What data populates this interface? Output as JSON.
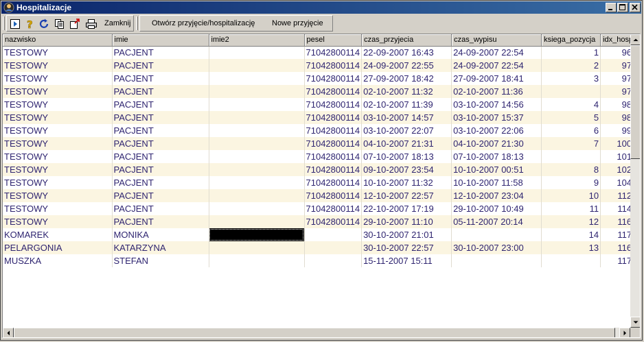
{
  "window": {
    "title": "Hospitalizacje"
  },
  "toolbar": {
    "icons": [
      "run-icon",
      "help-icon",
      "refresh-icon",
      "copy-icon",
      "export-icon",
      "print-icon"
    ],
    "close_label": "Zamknij",
    "open_admission_label": "Otwórz przyjęcie/hospitalizację",
    "new_admission_label": "Nowe przyjęcie"
  },
  "table": {
    "columns": [
      "nazwisko",
      "imie",
      "imie2",
      "pesel",
      "czas_przyjecia",
      "czas_wypisu",
      "ksiega_pozycja",
      "idx_hosp"
    ],
    "rows": [
      [
        "TESTOWY",
        "PACJENT",
        "",
        "71042800114",
        "22-09-2007 16:43",
        "24-09-2007 22:54",
        "1",
        "96"
      ],
      [
        "TESTOWY",
        "PACJENT",
        "",
        "71042800114",
        "24-09-2007 22:55",
        "24-09-2007 22:54",
        "2",
        "97"
      ],
      [
        "TESTOWY",
        "PACJENT",
        "",
        "71042800114",
        "27-09-2007 18:42",
        "27-09-2007 18:41",
        "3",
        "97"
      ],
      [
        "TESTOWY",
        "PACJENT",
        "",
        "71042800114",
        "02-10-2007 11:32",
        "02-10-2007 11:36",
        "",
        "97"
      ],
      [
        "TESTOWY",
        "PACJENT",
        "",
        "71042800114",
        "02-10-2007 11:39",
        "03-10-2007 14:56",
        "4",
        "98"
      ],
      [
        "TESTOWY",
        "PACJENT",
        "",
        "71042800114",
        "03-10-2007 14:57",
        "03-10-2007 15:37",
        "5",
        "98"
      ],
      [
        "TESTOWY",
        "PACJENT",
        "",
        "71042800114",
        "03-10-2007 22:07",
        "03-10-2007 22:06",
        "6",
        "99"
      ],
      [
        "TESTOWY",
        "PACJENT",
        "",
        "71042800114",
        "04-10-2007 21:31",
        "04-10-2007 21:30",
        "7",
        "100"
      ],
      [
        "TESTOWY",
        "PACJENT",
        "",
        "71042800114",
        "07-10-2007 18:13",
        "07-10-2007 18:13",
        "",
        "101"
      ],
      [
        "TESTOWY",
        "PACJENT",
        "",
        "71042800114",
        "09-10-2007 23:54",
        "10-10-2007 00:51",
        "8",
        "102"
      ],
      [
        "TESTOWY",
        "PACJENT",
        "",
        "71042800114",
        "10-10-2007 11:32",
        "10-10-2007 11:58",
        "9",
        "104"
      ],
      [
        "TESTOWY",
        "PACJENT",
        "",
        "71042800114",
        "12-10-2007 22:57",
        "12-10-2007 23:04",
        "10",
        "112"
      ],
      [
        "TESTOWY",
        "PACJENT",
        "",
        "71042800114",
        "22-10-2007 17:19",
        "29-10-2007 10:49",
        "11",
        "114"
      ],
      [
        "TESTOWY",
        "PACJENT",
        "",
        "71042800114",
        "29-10-2007 11:10",
        "05-11-2007 20:14",
        "12",
        "116"
      ],
      [
        "KOMAREK",
        "MONIKA",
        "",
        "",
        "30-10-2007 21:01",
        "",
        "14",
        "117"
      ],
      [
        "PELARGONIA",
        "KATARZYNA",
        "",
        "",
        "30-10-2007 22:57",
        "30-10-2007 23:00",
        "13",
        "116"
      ],
      [
        "MUSZKA",
        "STEFAN",
        "",
        "",
        "15-11-2007 15:11",
        "",
        "",
        "117"
      ]
    ],
    "redacted_cell": {
      "row": 14,
      "col": 2
    }
  },
  "colors": {
    "title_bar": "#0a246a",
    "row_alt": "#fbf5e1",
    "text": "#2e2470"
  }
}
